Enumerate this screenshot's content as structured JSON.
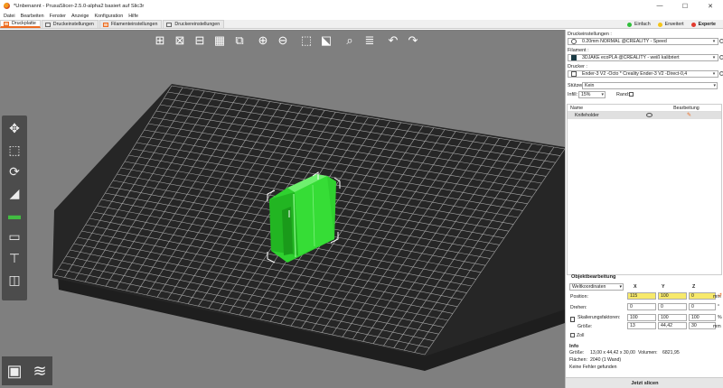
{
  "window": {
    "title": "*Unbenannt - PrusaSlicer-2.5.0-alpha2 basiert auf Slic3r",
    "controls": [
      "—",
      "☐",
      "✕"
    ]
  },
  "menu": [
    "Datei",
    "Bearbeiten",
    "Fenster",
    "Anzeige",
    "Konfiguration",
    "Hilfe"
  ],
  "tabs": [
    {
      "label": "Druckplatte",
      "active": true
    },
    {
      "label": "Druckeinstellungen",
      "active": false
    },
    {
      "label": "Filamenteinstellungen",
      "active": false
    },
    {
      "label": "Druckereinstellungen",
      "active": false
    }
  ],
  "modes": [
    {
      "label": "Einfach",
      "color": "#2fbf3a"
    },
    {
      "label": "Erweitert",
      "color": "#f5c518"
    },
    {
      "label": "Experte",
      "color": "#e23a2e"
    }
  ],
  "sidebar": {
    "print_settings_label": "Druckeinstellungen :",
    "print_settings_value": "0.20mm NORMAL @CREALITY - Speed",
    "filament_label": "Filament :",
    "filament_value": "3DJAKE ecoPLA @CREALITY - weiß kalibriert",
    "filament_color": "#1a3a44",
    "printer_label": "Drucker :",
    "printer_value": "Ender-3 V2 -Octo * Creality Ender-3 V2 -Direct-0,4",
    "supports_label": "Stützen:",
    "supports_value": "Kein",
    "infill_label": "Infill:",
    "infill_value": "15%",
    "brim_label": "Rand:"
  },
  "objects": {
    "col_name": "Name",
    "col_edit": "Bearbeitung",
    "rows": [
      {
        "name": "Knifeholder"
      }
    ]
  },
  "object_edit": {
    "title": "Objektbearbeitung",
    "coord_system": "Weltkoordinaten",
    "axes": [
      "X",
      "Y",
      "Z"
    ],
    "position_label": "Position:",
    "position": [
      "115",
      "100",
      "0"
    ],
    "position_unit": "mm",
    "rotate_label": "Drehen:",
    "rotate": [
      "0",
      "0",
      "0"
    ],
    "rotate_unit": "°",
    "scale_label": "Skalierungsfaktoren:",
    "scale": [
      "100",
      "100",
      "100"
    ],
    "scale_unit": "%",
    "size_label": "Größe:",
    "size": [
      "13",
      "44,42",
      "30"
    ],
    "size_unit": "mm",
    "drop_label": "Zoll"
  },
  "info": {
    "title": "Info",
    "size_label": "Größe:",
    "size_value": "13,00 x 44,42 x 30,00",
    "volume_label": "Volumen:",
    "volume_value": "6821,95",
    "facets_label": "Flächen:",
    "facets_value": "2040 (1 Wand)",
    "status": "Keine Fehler gefunden"
  },
  "slice_button": "Jetzt slicen",
  "colors": {
    "accent": "#ed6b21",
    "model": "#2fd12f",
    "bed": "#262626",
    "viewport_bg": "#7f7f7f"
  }
}
